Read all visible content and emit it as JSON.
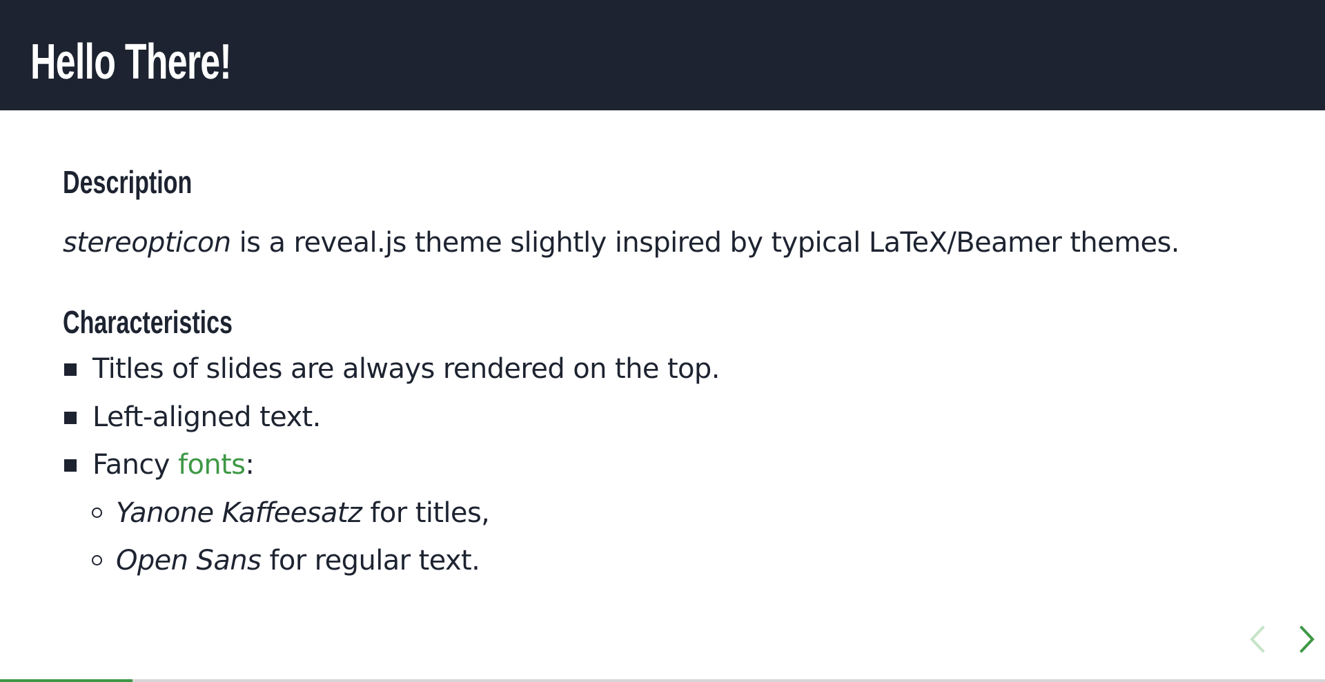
{
  "slide": {
    "title": "Hello There!",
    "progress": 0.1
  },
  "description": {
    "heading": "Description",
    "emphasis": "stereopticon",
    "text": " is a reveal.js theme slightly inspired by typical LaTeX/Beamer themes."
  },
  "characteristics": {
    "heading": "Characteristics",
    "items": [
      {
        "text": "Titles of slides are always rendered on the top."
      },
      {
        "text": "Left-aligned text."
      },
      {
        "text_before": "Fancy ",
        "link": "fonts",
        "text_after": ":"
      }
    ],
    "subitems": [
      {
        "emphasis": "Yanone Kaffeesatz",
        "text": " for titles,"
      },
      {
        "emphasis": "Open Sans",
        "text": " for regular text."
      }
    ]
  },
  "navigation": {
    "prev_icon": "chevron-left-icon",
    "next_icon": "chevron-right-icon"
  },
  "colors": {
    "header_bg": "#1d2330",
    "accent": "#3e9845",
    "accent_light": "#c6e4c8",
    "text": "#1d2330"
  }
}
